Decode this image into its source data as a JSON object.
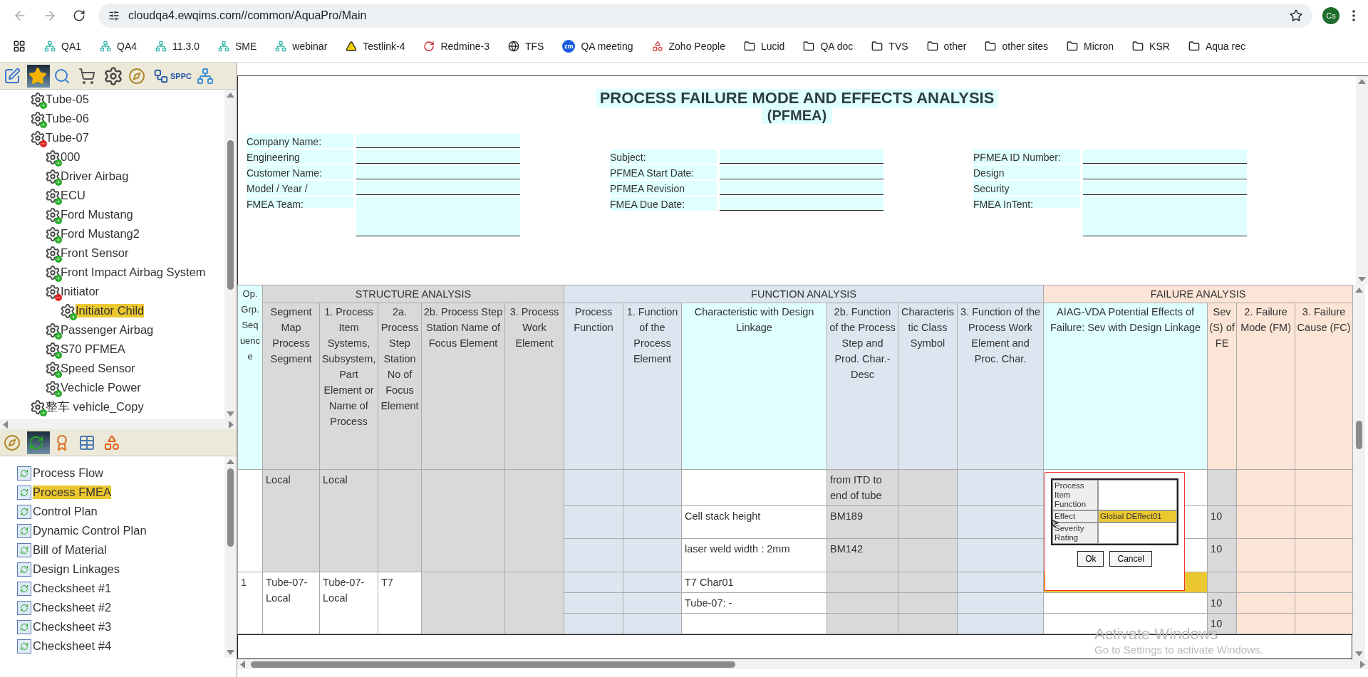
{
  "browser": {
    "url": "cloudqa4.ewqims.com//common/AquaPro/Main",
    "profile": "Cs",
    "bookmarks": [
      {
        "kind": "qims",
        "label": "QA1"
      },
      {
        "kind": "qims",
        "label": "QA4"
      },
      {
        "kind": "qims",
        "label": "11.3.0"
      },
      {
        "kind": "qims",
        "label": "SME"
      },
      {
        "kind": "qims",
        "label": "webinar"
      },
      {
        "kind": "testlink",
        "label": "Testlink-4"
      },
      {
        "kind": "redmine",
        "label": "Redmine-3"
      },
      {
        "kind": "globe",
        "label": "TFS"
      },
      {
        "kind": "zoom",
        "badge": "zm",
        "label": "QA meeting"
      },
      {
        "kind": "zoho",
        "label": "Zoho People"
      },
      {
        "kind": "folder",
        "label": "Lucid"
      },
      {
        "kind": "folder",
        "label": "QA doc"
      },
      {
        "kind": "folder",
        "label": "TVS"
      },
      {
        "kind": "folder",
        "label": "other"
      },
      {
        "kind": "folder",
        "label": "other sites"
      },
      {
        "kind": "folder",
        "label": "Micron"
      },
      {
        "kind": "folder",
        "label": "KSR"
      },
      {
        "kind": "folder",
        "label": "Aqua rec"
      }
    ]
  },
  "sidebar": {
    "toolbar": [
      {
        "kind": "edit",
        "selected": false
      },
      {
        "kind": "star",
        "selected": true
      },
      {
        "kind": "search",
        "selected": false
      },
      {
        "kind": "cart",
        "selected": false
      },
      {
        "kind": "gear",
        "selected": false
      },
      {
        "kind": "drafting",
        "selected": false
      },
      {
        "kind": "flow",
        "label": "SPPC",
        "selected": false
      },
      {
        "kind": "network",
        "selected": false
      }
    ],
    "tree": [
      {
        "label": "Tube-05",
        "expanded": false,
        "selected": false
      },
      {
        "label": "Tube-06",
        "expanded": false,
        "selected": false
      },
      {
        "label": "Tube-07",
        "expanded": true,
        "selected": false,
        "children": [
          {
            "label": "000",
            "expanded": false,
            "selected": false
          },
          {
            "label": "Driver Airbag",
            "expanded": false,
            "selected": false
          },
          {
            "label": "ECU",
            "expanded": false,
            "selected": false
          },
          {
            "label": "Ford Mustang",
            "expanded": false,
            "selected": false
          },
          {
            "label": "Ford Mustang2",
            "expanded": false,
            "selected": false
          },
          {
            "label": "Front Sensor",
            "expanded": false,
            "selected": false
          },
          {
            "label": "Front Impact Airbag System",
            "expanded": false,
            "selected": false
          },
          {
            "label": "Initiator",
            "expanded": true,
            "selected": false,
            "children": [
              {
                "label": "Initiator Child",
                "expanded": false,
                "selected": true
              }
            ]
          },
          {
            "label": "Passenger Airbag",
            "expanded": false,
            "selected": false
          },
          {
            "label": "S70 PFMEA",
            "expanded": false,
            "selected": false
          },
          {
            "label": "Speed Sensor",
            "expanded": false,
            "selected": false
          },
          {
            "label": "Vechicle Power",
            "expanded": false,
            "selected": false
          }
        ]
      },
      {
        "label": "整车 vehicle_Copy",
        "expanded": false,
        "selected": false
      }
    ],
    "doc_toolbar": [
      {
        "kind": "drafting",
        "selected": false
      },
      {
        "kind": "document",
        "selected": true
      },
      {
        "kind": "certificate",
        "selected": false
      },
      {
        "kind": "tables",
        "selected": false
      },
      {
        "kind": "shapes",
        "selected": false
      }
    ],
    "documents": [
      {
        "label": "Process Flow",
        "selected": false
      },
      {
        "label": "Process FMEA",
        "selected": true
      },
      {
        "label": "Control Plan",
        "selected": false
      },
      {
        "label": "Dynamic Control Plan",
        "selected": false
      },
      {
        "label": "Bill of Material",
        "selected": false
      },
      {
        "label": "Design Linkages",
        "selected": false
      },
      {
        "label": "Checksheet #1",
        "selected": false
      },
      {
        "label": "Checksheet #2",
        "selected": false
      },
      {
        "label": "Checksheet #3",
        "selected": false
      },
      {
        "label": "Checksheet #4",
        "selected": false
      }
    ]
  },
  "form": {
    "title": "PROCESS FAILURE MODE AND EFFECTS ANALYSIS",
    "subtitle": "(PFMEA)",
    "columns": [
      [
        {
          "label": "Company Name:",
          "kind": "line"
        },
        {
          "label": "Engineering",
          "kind": "line"
        },
        {
          "label": "Customer Name:",
          "kind": "line"
        },
        {
          "label": "Model / Year /",
          "kind": "line"
        },
        {
          "label": "FMEA Team:",
          "kind": "area"
        }
      ],
      [
        {
          "label": "Subject:",
          "kind": "line"
        },
        {
          "label": "PFMEA Start Date:",
          "kind": "line"
        },
        {
          "label": "PFMEA Revision",
          "kind": "line"
        },
        {
          "label": "FMEA Due Date:",
          "kind": "line"
        }
      ],
      [
        {
          "label": "PFMEA ID Number:",
          "kind": "line"
        },
        {
          "label": "Design",
          "kind": "line"
        },
        {
          "label": "Security",
          "kind": "line"
        },
        {
          "label": "FMEA InTent:",
          "kind": "area"
        }
      ]
    ]
  },
  "table": {
    "first_column": "Op. Grp. Sequence",
    "column_groups": [
      {
        "label": "STRUCTURE ANALYSIS",
        "columns": [
          "Segment Map Process Segment",
          "1. Process Item Systems, Subsystem, Part Element or Name of Process",
          "2a. Process Step Station No of Focus Element",
          "2b. Process Step Station Name of Focus Element",
          "3. Process Work Element"
        ]
      },
      {
        "label": "FUNCTION ANALYSIS",
        "columns": [
          "Process Function",
          "1. Function of the Process Element",
          "Characteristic with Design Linkage",
          "2b. Function of the Process Step and Prod. Char.-Desc",
          "Characteristic Class Symbol",
          "3. Function of the Process Work Element and Proc. Char."
        ]
      },
      {
        "label": "FAILURE ANALYSIS",
        "columns": [
          "AIAG-VDA Potential Effects of Failure: Sev with Design Linkage",
          "Sev (S) of FE",
          "2. Failure Mode (FM)",
          "3. Failure Cause (FC)"
        ]
      }
    ],
    "groups": [
      {
        "shaded": true,
        "segment": "Local",
        "process_item": "Local",
        "lines": [
          {
            "function_step": "from ITD to end of tube",
            "highlighted": false
          },
          {
            "characteristic": "Cell stack height",
            "function_step": "BM189",
            "severity": "10",
            "highlighted": false
          },
          {
            "characteristic": "laser weld width : 2mm",
            "function_step": "BM142",
            "severity": "10",
            "highlighted": false
          }
        ]
      },
      {
        "shaded": false,
        "op": "1",
        "segment": "Tube-07-Local",
        "process_item": "Tube-07-Local",
        "step_station": "T7",
        "lines": [
          {
            "characteristic": "T7 Char01",
            "highlighted": true
          },
          {
            "characteristic": "Tube-07: -",
            "severity": "10",
            "highlighted": false
          },
          {
            "severity": "10",
            "highlighted": false
          }
        ]
      }
    ]
  },
  "popup": {
    "rows": [
      {
        "label": "Process Item Function",
        "highlighted": false
      },
      {
        "label": "Effect",
        "value": "Global DEffect01",
        "highlighted": true
      },
      {
        "label": "Severity Rating",
        "highlighted": false
      }
    ],
    "buttons": [
      "Ok",
      "Cancel"
    ]
  },
  "os_notice": {
    "title": "Activate Windows",
    "subtitle": "Go to Settings to activate Windows."
  }
}
